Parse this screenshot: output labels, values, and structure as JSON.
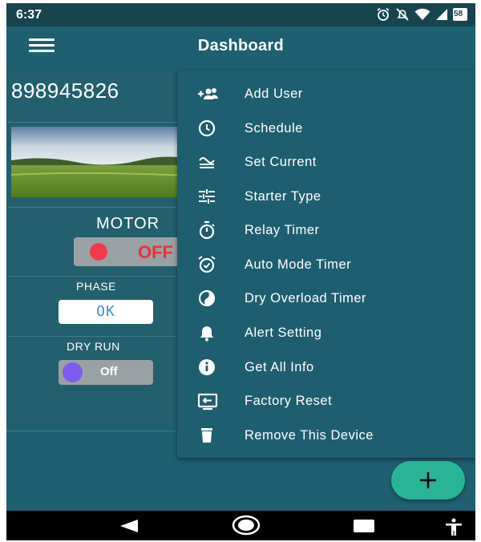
{
  "status_bar": {
    "time": "6:37",
    "icons": [
      "alarm-icon",
      "mute-icon",
      "wifi-icon",
      "signal-icon",
      "battery-icon"
    ],
    "battery_text": "58"
  },
  "app_bar": {
    "title": "Dashboard",
    "menu_icon": "hamburger-icon"
  },
  "device_card": {
    "device_id": "898945826",
    "motor": {
      "label": "MOTOR",
      "state": "OFF",
      "indicator_color": "#f23a4e"
    },
    "phase": {
      "label": "PHASE",
      "value": "OK"
    },
    "dry_run": {
      "label": "DRY RUN",
      "state": "Off",
      "indicator_color": "#7e5cf1"
    }
  },
  "menu": {
    "items": [
      {
        "label": "Add User",
        "icon": "add-user-icon"
      },
      {
        "label": "Schedule",
        "icon": "clock-icon"
      },
      {
        "label": "Set Current",
        "icon": "current-icon"
      },
      {
        "label": "Starter Type",
        "icon": "sliders-icon"
      },
      {
        "label": "Relay Timer",
        "icon": "timer-icon"
      },
      {
        "label": "Auto Mode Timer",
        "icon": "alarm-clock-icon"
      },
      {
        "label": "Dry Overload Timer",
        "icon": "dry-overload-icon"
      },
      {
        "label": "Alert Setting",
        "icon": "bell-icon"
      },
      {
        "label": "Get All Info",
        "icon": "info-icon"
      },
      {
        "label": "Factory Reset",
        "icon": "factory-reset-icon"
      },
      {
        "label": "Remove This Device",
        "icon": "trash-icon"
      }
    ]
  },
  "fab": {
    "icon": "plus-icon",
    "color": "#29b497"
  },
  "nav_bar": {
    "icons": [
      "back-icon",
      "home-icon",
      "recents-icon",
      "accessibility-icon"
    ]
  },
  "colors": {
    "background": "#1e5f70",
    "status_bar": "#17444f",
    "menu_background": "#1f5e6e"
  }
}
